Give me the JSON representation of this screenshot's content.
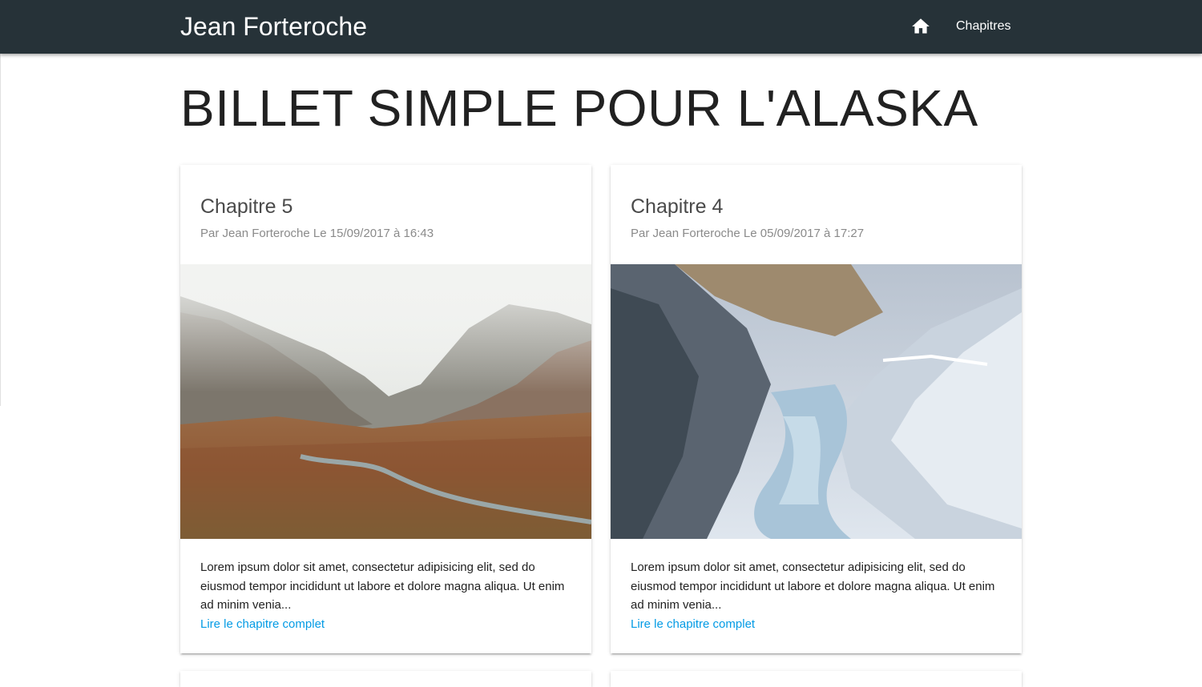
{
  "nav": {
    "brand": "Jean Forteroche",
    "home_icon": "home-icon",
    "chapters_link": "Chapitres",
    "background": "#263238"
  },
  "page": {
    "title": "BILLET SIMPLE POUR L'ALASKA"
  },
  "posts": [
    {
      "title": "Chapitre 5",
      "meta": "Par Jean Forteroche Le 15/09/2017 à 16:43",
      "image": "autumn-valley-mountains-river",
      "excerpt": "Lorem ipsum dolor sit amet, consectetur adipisicing elit, sed do eiusmod tempor incididunt ut labore et dolore magna aliqua. Ut enim ad minim venia...",
      "link": "Lire le chapitre complet"
    },
    {
      "title": "Chapitre 4",
      "meta": "Par Jean Forteroche Le 05/09/2017 à 17:27",
      "image": "snowy-canyon-frozen-river",
      "excerpt": "Lorem ipsum dolor sit amet, consectetur adipisicing elit, sed do eiusmod tempor incididunt ut labore et dolore magna aliqua. Ut enim ad minim venia...",
      "link": "Lire le chapitre complet"
    }
  ],
  "colors": {
    "link": "#039be5",
    "title_text": "#212121",
    "meta_text": "#8a8a8a"
  }
}
